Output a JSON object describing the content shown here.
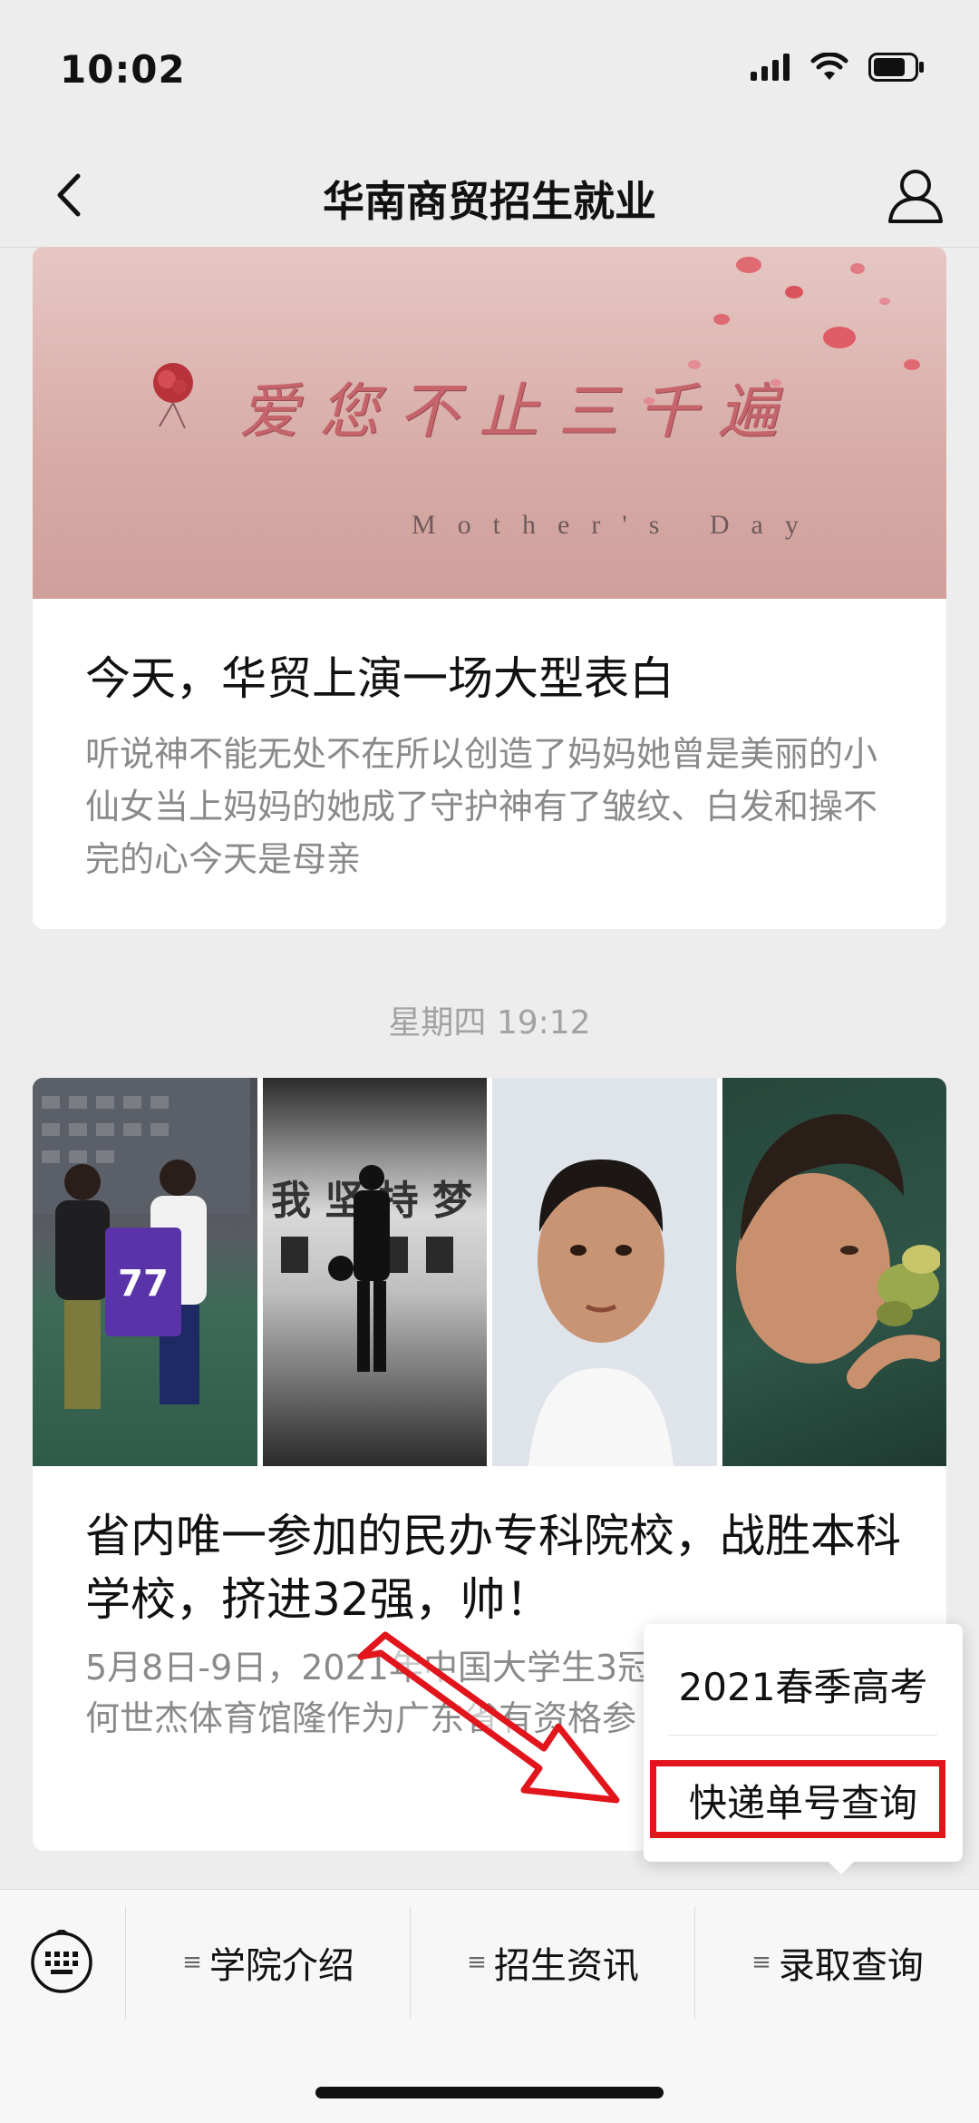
{
  "status": {
    "time": "10:02"
  },
  "header": {
    "title": "华南商贸招生就业"
  },
  "article1": {
    "banner_text": "爱您不止三千遍",
    "banner_subtext": "Mother's Day",
    "title": "今天，华贸上演一场大型表白",
    "desc": "听说神不能无处不在所以创造了妈妈她曾是美丽的小仙女当上妈妈的她成了守护神有了皱纹、白发和操不完的心今天是母亲"
  },
  "timestamp": "星期四 19:12",
  "article2": {
    "photo_text": {
      "jersey_number": "77",
      "wall_text": "我 坚 持 梦"
    },
    "title": "省内唯一参加的民办专科院校，战胜本科学校，挤进32强，帅！",
    "desc": "5月8日-9日，2021年中国大学生3冠军赛在广州大学何世杰体育馆隆作为广东省有资格参"
  },
  "popup": {
    "items": [
      "2021春季高考",
      "快递单号查询"
    ]
  },
  "menu": {
    "prefix": "≡",
    "items": [
      "学院介绍",
      "招生资讯",
      "录取查询"
    ]
  },
  "colors": {
    "highlight": "#e1151b",
    "background": "#ededed"
  }
}
